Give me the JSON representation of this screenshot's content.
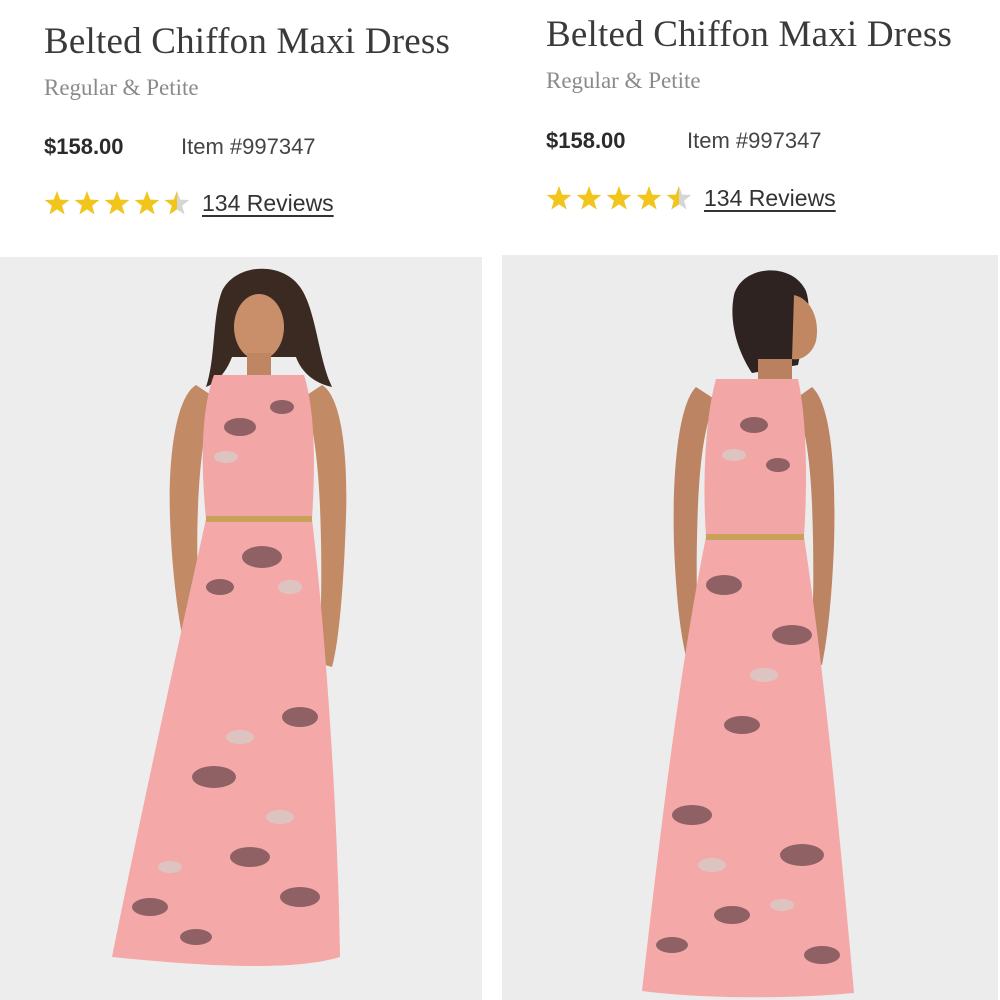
{
  "products": [
    {
      "title": "Belted Chiffon Maxi Dress",
      "subtitle": "Regular & Petite",
      "price": "$158.00",
      "item_number": "Item #997347",
      "rating": 4.5,
      "reviews_label": "134 Reviews",
      "photo_view": "front"
    },
    {
      "title": "Belted Chiffon Maxi Dress",
      "subtitle": "Regular & Petite",
      "price": "$158.00",
      "item_number": "Item #997347",
      "rating": 4.5,
      "reviews_label": "134 Reviews",
      "photo_view": "back"
    }
  ],
  "colors": {
    "star": "#f1c51c",
    "star_empty": "#d6d6d6",
    "dress": "#f4a9a8",
    "photo_bg": "#ededee"
  },
  "icons": {
    "star": "star-icon",
    "half_star": "half-star-icon"
  }
}
